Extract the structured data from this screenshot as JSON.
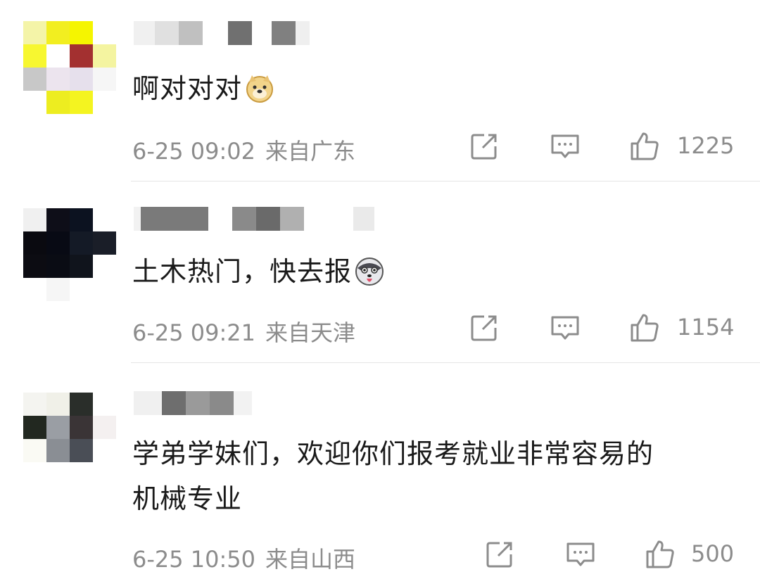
{
  "comments": [
    {
      "text": "啊对对对",
      "emoji": "doge-emoji",
      "date": "6-25 09:02",
      "location": "来自广东",
      "likes": "1225",
      "avatar_colors": [
        "#f4f4a8",
        "#f2ee20",
        "#f5f500",
        "#ffffff",
        "#f7f730",
        "#ffffff",
        "#a33030",
        "#f4f4a0",
        "#c8c8c8",
        "#ece4ee",
        "#e6e0ec",
        "#f6f6f6",
        "#ffffff",
        "#eded20",
        "#f4f420",
        "#ffffff"
      ]
    },
    {
      "text": "土木热门，快去报",
      "emoji": "husky-emoji",
      "date": "6-25 09:21",
      "location": "来自天津",
      "likes": "1154",
      "avatar_colors": [
        "#f0f0f0",
        "#0e0e18",
        "#0c1220",
        "#ffffff",
        "#0a0a10",
        "#080a14",
        "#141a26",
        "#1a1e28",
        "#0c0c12",
        "#0a0c14",
        "#10141c",
        "#ffffff",
        "#ffffff",
        "#f6f6f6",
        "#ffffff",
        "#ffffff"
      ]
    },
    {
      "text_lines": [
        "学弟学妹们，欢迎你们报考就业非常容易的",
        "机械专业"
      ],
      "date": "6-25 10:50",
      "location": "来自山西",
      "likes": "500",
      "avatar_colors": [
        "#f4f4f0",
        "#f0f0e8",
        "#2a2e2a",
        "#ffffff",
        "#222820",
        "#9a9ea4",
        "#3a3436",
        "#f4f0f0",
        "#fafaf4",
        "#8a8e94",
        "#4a4e56",
        "#ffffff",
        "#ffffff",
        "#ffffff",
        "#ffffff",
        "#ffffff"
      ]
    }
  ],
  "icons": {
    "share": "share-icon",
    "reply": "comment-icon",
    "like": "thumbs-up-icon"
  }
}
